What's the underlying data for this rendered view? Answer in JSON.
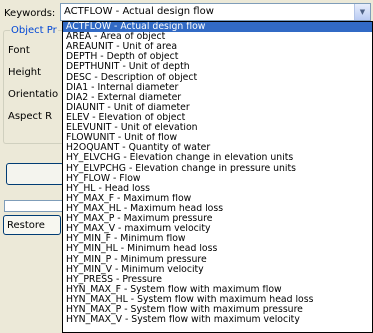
{
  "keywords": {
    "label": "Keywords:",
    "value": "ACTFLOW  -  Actual design flow"
  },
  "object_panel": {
    "group_title": "Object Pr",
    "labels": [
      "Font",
      "Height",
      "Orientatio",
      "Aspect R"
    ]
  },
  "restore_label": "Restore",
  "dropdown_items": [
    "ACTFLOW  -  Actual design flow",
    "AREA  -  Area of object",
    "AREAUNIT  -  Unit of area",
    "DEPTH  -  Depth of object",
    "DEPTHUNIT  -  Unit of depth",
    "DESC  -  Description of object",
    "DIA1  -  Internal diameter",
    "DIA2  -  External diameter",
    "DIAUNIT  -  Unit of diameter",
    "ELEV  -  Elevation of object",
    "ELEVUNIT  -  Unit of elevation",
    "FLOWUNIT  -  Unit of flow",
    "H2OQUANT  -  Quantity of water",
    "HY_ELVCHG  -  Elevation change in elevation units",
    "HY_ELVPCHG  -  Elevation change in pressure units",
    "HY_FLOW  -  Flow",
    "HY_HL  -  Head loss",
    "HY_MAX_F  -  Maximum flow",
    "HY_MAX_HL  -  Maximum head loss",
    "HY_MAX_P  -  Maximum pressure",
    "HY_MAX_V  -  maximum velocity",
    "HY_MIN_F  -  Minimum flow",
    "HY_MIN_HL  -  Minimum head loss",
    "HY_MIN_P  -  Minimum pressure",
    "HY_MIN_V  -  Minimum velocity",
    "HY_PRESS  -  Pressure",
    "HYN_MAX_F  -  System flow with maximum flow",
    "HYN_MAX_HL  -  System flow with maximum head loss",
    "HYN_MAX_P  -  System flow with maximum pressure",
    "HYN_MAX_V  -  System flow with maximum velocity"
  ],
  "selected_index": 0
}
